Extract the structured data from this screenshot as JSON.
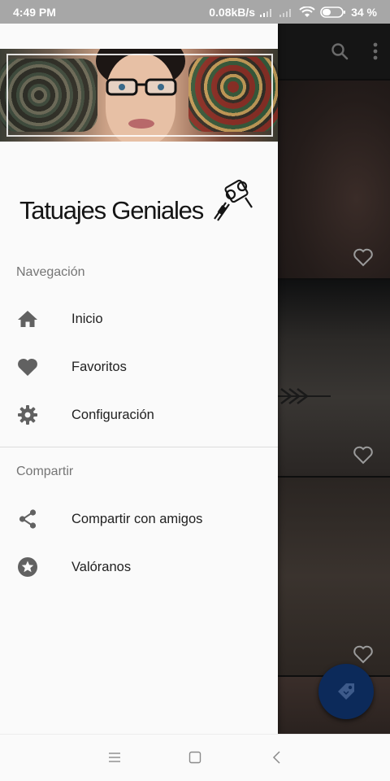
{
  "status_bar": {
    "time": "4:49 PM",
    "network_speed": "0.08kB/s",
    "battery": "34 %",
    "icons": [
      "signal-icon",
      "signal-icon",
      "wifi-icon",
      "battery-icon"
    ]
  },
  "drawer": {
    "logo_text": "Tatuajes Geniales",
    "sections": [
      {
        "title": "Navegación",
        "items": [
          {
            "label": "Inicio",
            "icon": "home-icon"
          },
          {
            "label": "Favoritos",
            "icon": "heart-icon"
          },
          {
            "label": "Configuración",
            "icon": "gear-icon"
          }
        ]
      },
      {
        "title": "Compartir",
        "items": [
          {
            "label": "Compartir con amigos",
            "icon": "share-icon"
          },
          {
            "label": "Valóranos",
            "icon": "star-icon"
          }
        ]
      }
    ]
  },
  "toolbar": {
    "icons": [
      "search-icon",
      "more-vert-icon"
    ]
  },
  "fab": {
    "icon": "tag-icon",
    "color": "#0c2a5a"
  },
  "nav_bar": {
    "icons": [
      "menu-icon",
      "home-square-icon",
      "back-icon"
    ]
  },
  "colors": {
    "drawer_bg": "#fafafa",
    "icon_gray": "#616161",
    "label_gray": "#757575",
    "status_bar": "#a7a7a7"
  }
}
